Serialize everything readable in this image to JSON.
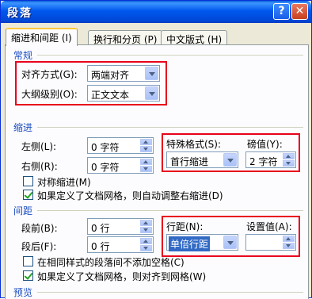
{
  "window": {
    "title": "段落"
  },
  "title_buttons": {
    "help": "?",
    "close": "✕"
  },
  "tabs": [
    {
      "label": "缩进和间距 (I)"
    },
    {
      "label": "换行和分页 (P)"
    },
    {
      "label": "中文版式 (H)"
    }
  ],
  "general": {
    "section": "常规",
    "alignment_label": "对齐方式(G):",
    "alignment_value": "两端对齐",
    "outline_label": "大纲级别(O):",
    "outline_value": "正文文本"
  },
  "indent": {
    "section": "缩进",
    "left_label": "左侧(L):",
    "left_value": "0 字符",
    "right_label": "右侧(R):",
    "right_value": "0 字符",
    "special_label": "特殊格式(S):",
    "special_value": "首行缩进",
    "by_label": "磅值(Y):",
    "by_value": "2 字符",
    "mirror_label": "对称缩进(M)",
    "mirror_checked": false,
    "auto_adjust_label": "如果定义了文档网格，则自动调整右缩进(D)",
    "auto_adjust_checked": true
  },
  "spacing": {
    "section": "间距",
    "before_label": "段前(B):",
    "before_value": "0 行",
    "after_label": "段后(F):",
    "after_value": "0 行",
    "line_label": "行距(N):",
    "line_value": "单倍行距",
    "at_label": "设置值(A):",
    "at_value": "",
    "no_space_label": "在相同样式的段落间不添加空格(C)",
    "no_space_checked": false,
    "snap_grid_label": "如果定义了文档网格，则对齐到网格(W)",
    "snap_grid_checked": true
  },
  "preview": {
    "section": "预览"
  },
  "colors": {
    "highlight_box": "#e8001c",
    "section_text": "#1d4ec2",
    "title_bar": "#0058ee"
  }
}
